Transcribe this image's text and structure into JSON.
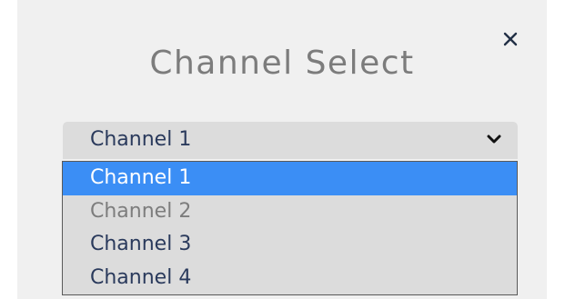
{
  "dialog": {
    "title": "Channel Select",
    "close_icon": "close-icon"
  },
  "select": {
    "value": "Channel 1",
    "chevron_icon": "chevron-down-icon",
    "options": [
      {
        "label": "Channel 1",
        "state": "selected"
      },
      {
        "label": "Channel 2",
        "state": "disabled"
      },
      {
        "label": "Channel 3",
        "state": "normal"
      },
      {
        "label": "Channel 4",
        "state": "normal"
      }
    ]
  },
  "colors": {
    "highlight": "#3b8ef5",
    "text": "#2a3a5c",
    "title": "#7c7c7c",
    "disabled_text": "#7d7d7d",
    "background": "#f0f0f0"
  }
}
